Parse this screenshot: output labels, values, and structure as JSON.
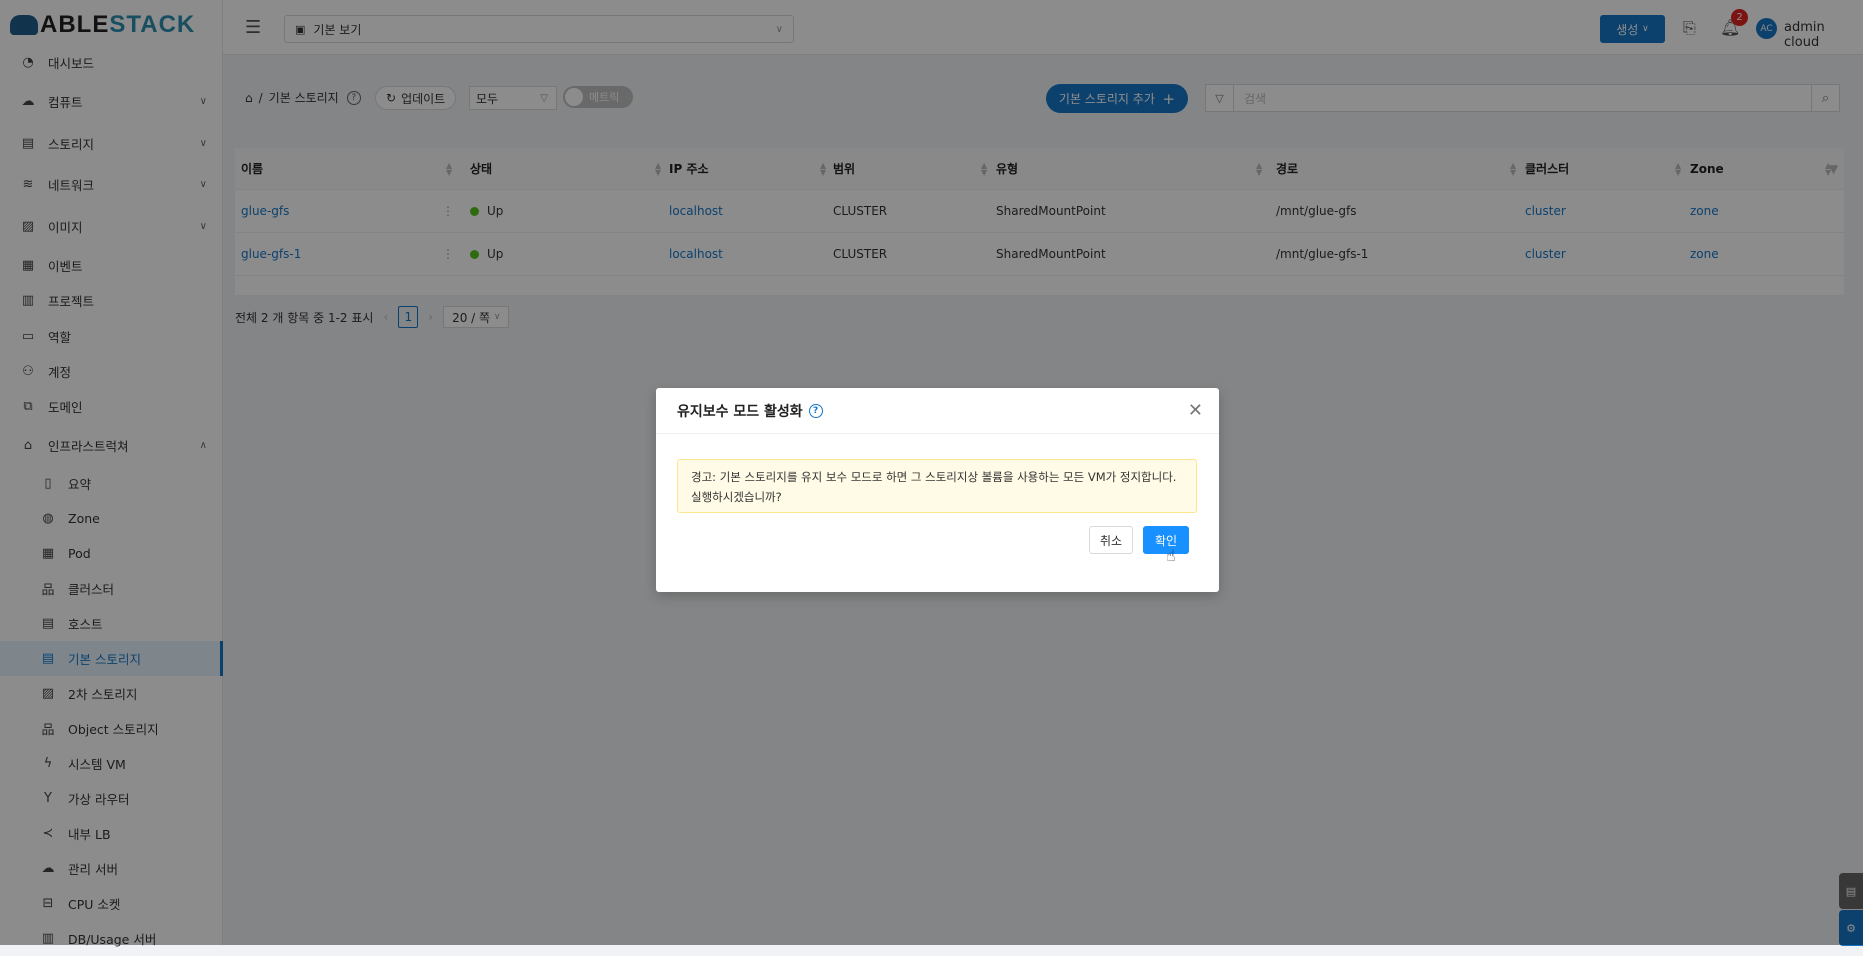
{
  "brand": {
    "logo_a": "ABLE",
    "logo_b": "STACK"
  },
  "sidebar": {
    "items": [
      {
        "label": "대시보드",
        "icon": "dashboard-icon"
      },
      {
        "label": "컴퓨트",
        "icon": "cloud-icon",
        "chevron": "v"
      },
      {
        "label": "스토리지",
        "icon": "storage-icon",
        "chevron": "v"
      },
      {
        "label": "네트워크",
        "icon": "wifi-icon",
        "chevron": "v"
      },
      {
        "label": "이미지",
        "icon": "image-icon",
        "chevron": "v"
      },
      {
        "label": "이벤트",
        "icon": "calendar-icon"
      },
      {
        "label": "프로젝트",
        "icon": "project-icon"
      },
      {
        "label": "역할",
        "icon": "idcard-icon"
      },
      {
        "label": "계정",
        "icon": "users-icon"
      },
      {
        "label": "도메인",
        "icon": "domain-icon"
      },
      {
        "label": "인프라스트럭쳐",
        "icon": "bank-icon",
        "chevron": "^"
      }
    ],
    "sub_items": [
      {
        "label": "요약"
      },
      {
        "label": "Zone"
      },
      {
        "label": "Pod"
      },
      {
        "label": "클러스터"
      },
      {
        "label": "호스트"
      },
      {
        "label": "기본 스토리지",
        "active": true
      },
      {
        "label": "2차 스토리지"
      },
      {
        "label": "Object 스토리지"
      },
      {
        "label": "시스템 VM"
      },
      {
        "label": "가상 라우터"
      },
      {
        "label": "내부 LB"
      },
      {
        "label": "관리 서버"
      },
      {
        "label": "CPU 소켓"
      },
      {
        "label": "DB/Usage 서버"
      }
    ]
  },
  "header": {
    "view_select": "기본 보기",
    "create_label": "생성",
    "notification_count": "2",
    "avatar_initials": "AC",
    "username": "admin cloud"
  },
  "toolbar": {
    "breadcrumb_page": "기본 스토리지",
    "refresh_label": "업데이트",
    "filter_value": "모두",
    "metrics_label": "메트릭",
    "add_label": "기본 스토리지 추가",
    "search_placeholder": "검색"
  },
  "table": {
    "columns": [
      "이름",
      "상태",
      "IP 주소",
      "범위",
      "유형",
      "경로",
      "클러스터",
      "Zone"
    ],
    "rows": [
      [
        "glue-gfs",
        "Up",
        "localhost",
        "CLUSTER",
        "SharedMountPoint",
        "/mnt/glue-gfs",
        "cluster",
        "zone"
      ],
      [
        "glue-gfs-1",
        "Up",
        "localhost",
        "CLUSTER",
        "SharedMountPoint",
        "/mnt/glue-gfs-1",
        "cluster",
        "zone"
      ]
    ]
  },
  "pagination": {
    "summary": "전체 2 개 항목 중 1-2 표시",
    "current_page": "1",
    "page_size": "20 / 쪽"
  },
  "modal": {
    "title": "유지보수 모드 활성화",
    "warning_line1": "경고: 기본 스토리지를 유지 보수 모드로 하면 그 스토리지상 볼륨을 사용하는 모든 VM가 정지합니다.",
    "warning_line2": "실행하시겠습니까?",
    "cancel_label": "취소",
    "ok_label": "확인"
  },
  "colors": {
    "primary": "#1677c9",
    "status_up": "#52c41a",
    "warning_bg": "#fffbe6"
  }
}
